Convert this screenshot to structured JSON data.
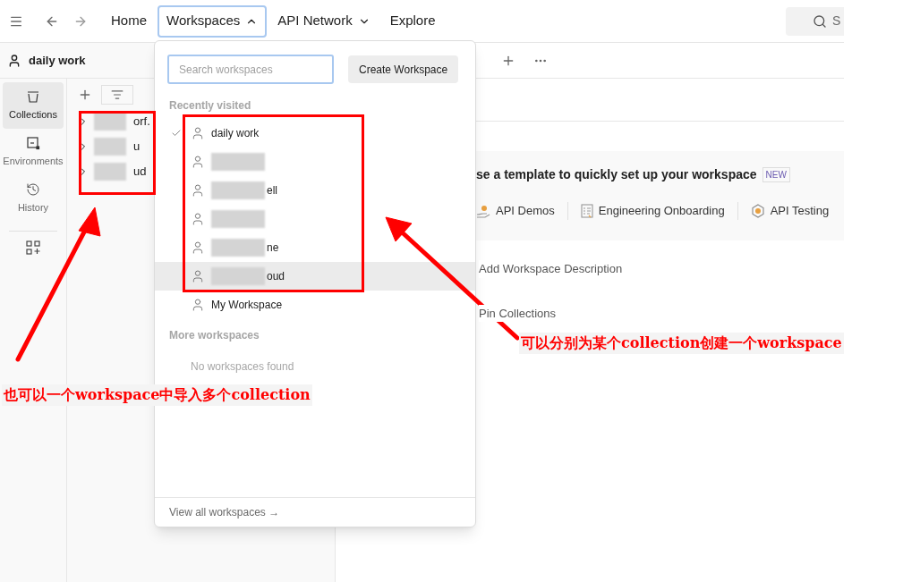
{
  "top_bar": {
    "nav": [
      {
        "label": "Home",
        "selected": false
      },
      {
        "label": "Workspaces",
        "selected": true,
        "expanded": true
      },
      {
        "label": "API Network",
        "selected": false,
        "expanded": false
      },
      {
        "label": "Explore",
        "selected": false
      }
    ],
    "search": {
      "placeholder": "S"
    }
  },
  "workspace_header": {
    "name": "daily work"
  },
  "rail": [
    {
      "label": "Collections",
      "selected": true,
      "kind": "collections"
    },
    {
      "label": "Environments",
      "selected": false,
      "kind": "environments"
    },
    {
      "label": "History",
      "selected": false,
      "kind": "history"
    }
  ],
  "collections": [
    {
      "label": "orf.",
      "redacted": true
    },
    {
      "label": "u",
      "redacted": true
    },
    {
      "label": "ud",
      "redacted": true
    }
  ],
  "dropdown": {
    "search": {
      "placeholder": "Search workspaces"
    },
    "create_button": "Create Workspace",
    "recent_heading": "Recently visited",
    "recent": [
      {
        "label": "daily work",
        "selected": true,
        "redacted": false,
        "hovered": false
      },
      {
        "selected": false,
        "redacted": true,
        "hovered": false
      },
      {
        "label": "ell",
        "selected": false,
        "redacted": true,
        "hovered": false
      },
      {
        "selected": false,
        "redacted": true,
        "hovered": false
      },
      {
        "label": "ne",
        "selected": false,
        "redacted": true,
        "hovered": false
      },
      {
        "label": "oud",
        "selected": false,
        "redacted": true,
        "hovered": true
      },
      {
        "label": "My Workspace",
        "selected": false,
        "redacted": false,
        "hovered": false
      }
    ],
    "more_heading": "More workspaces",
    "more_empty": "No workspaces found",
    "footer_link": "View all workspaces →"
  },
  "main": {
    "template_heading": "se a template to quickly set up your workspace",
    "badge": "NEW",
    "templates": [
      {
        "label": "API Demos",
        "kind": "demos"
      },
      {
        "label": "Engineering Onboarding",
        "kind": "onboarding"
      },
      {
        "label": "API Testing",
        "kind": "testing"
      }
    ],
    "actions": [
      "Add Workspace Description",
      "Pin Collections"
    ]
  },
  "annotations": [
    {
      "text": "也可以一个workspace中导入多个collection",
      "kind": "left"
    },
    {
      "text": "可以分别为某个collection创建一个workspace",
      "kind": "right"
    }
  ]
}
